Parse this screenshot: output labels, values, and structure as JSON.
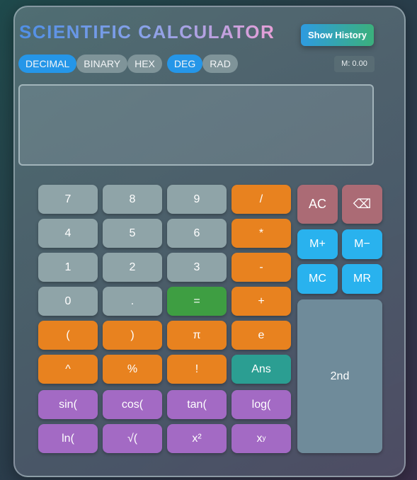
{
  "title": "SCIENTIFIC CALCULATOR",
  "history_button": "Show History",
  "base_modes": [
    "DECIMAL",
    "BINARY",
    "HEX"
  ],
  "angle_modes": [
    "DEG",
    "RAD"
  ],
  "active_base": "DECIMAL",
  "active_angle": "DEG",
  "memory": "M: 0.00",
  "display": {
    "value": ""
  },
  "keys": {
    "seven": "7",
    "eight": "8",
    "nine": "9",
    "divide": "/",
    "four": "4",
    "five": "5",
    "six": "6",
    "multiply": "*",
    "one": "1",
    "two": "2",
    "three": "3",
    "minus": "-",
    "zero": "0",
    "dot": ".",
    "equals": "=",
    "plus": "+",
    "lparen": "(",
    "rparen": ")",
    "pi": "π",
    "e": "e",
    "power": "^",
    "percent": "%",
    "factorial": "!",
    "ans": "Ans",
    "sin": "sin(",
    "cos": "cos(",
    "tan": "tan(",
    "log": "log(",
    "ln": "ln(",
    "sqrt": "√(",
    "square": "x²",
    "xy_base": "x",
    "xy_exp": "y",
    "ac": "AC",
    "backspace": "⌫",
    "mplus": "M+",
    "mminus": "M−",
    "mc": "MC",
    "mr": "MR",
    "second": "2nd"
  }
}
